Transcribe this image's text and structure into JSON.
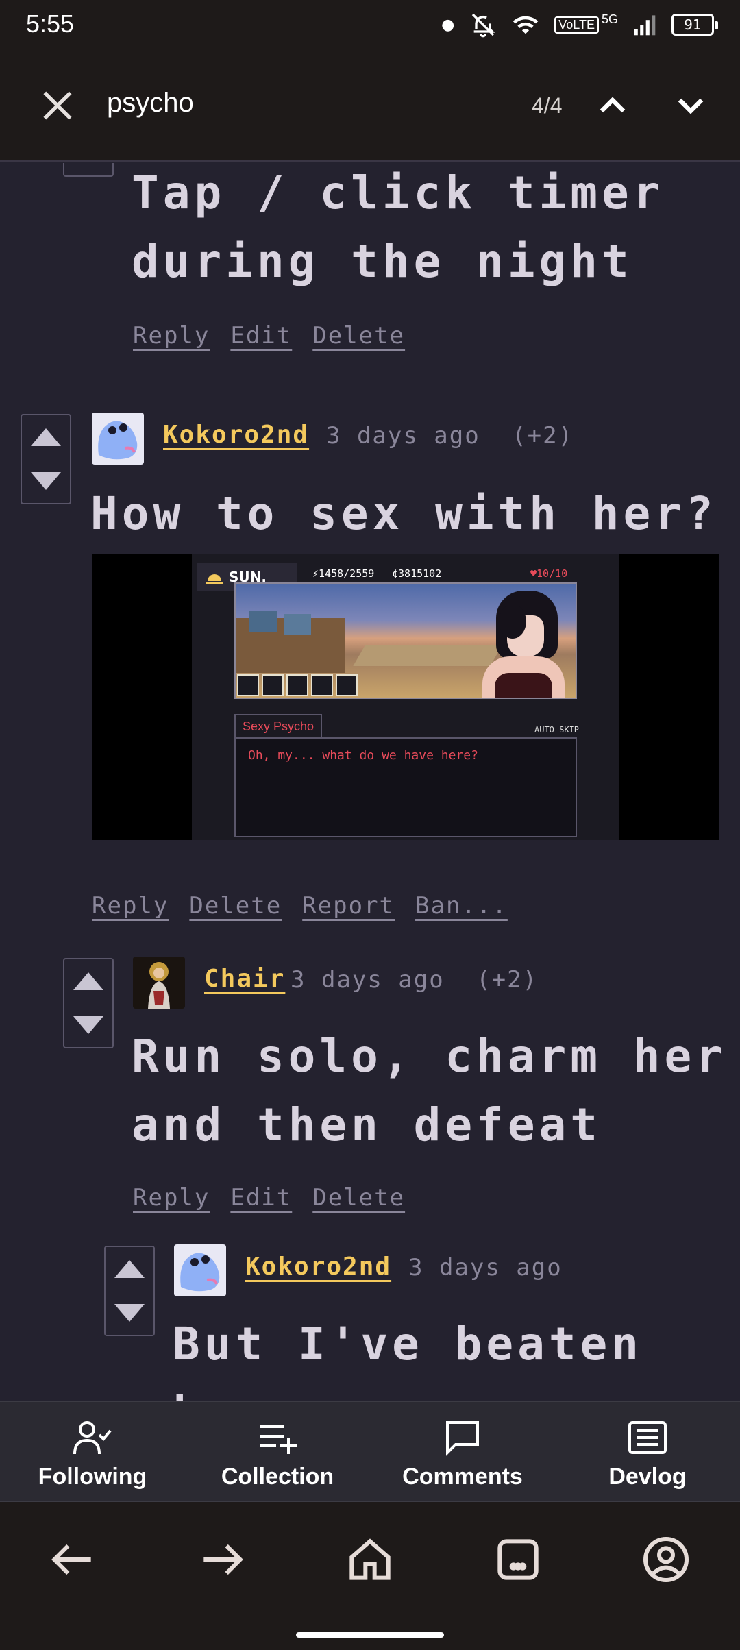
{
  "status": {
    "time": "5:55",
    "network": "5G",
    "volte": "VoLTE",
    "battery": "91"
  },
  "find": {
    "query": "psycho",
    "count": "4/4"
  },
  "comments": [
    {
      "text_lines": [
        "Tap / click timer",
        "during the night"
      ],
      "actions": [
        "Reply",
        "Edit",
        "Delete"
      ]
    },
    {
      "user": "Kokoro2nd",
      "time": "3 days ago",
      "score": "(+2)",
      "text_lines": [
        "How to sex with her?"
      ],
      "actions": [
        "Reply",
        "Delete",
        "Report",
        "Ban..."
      ]
    },
    {
      "user": "Chair",
      "time": "3 days ago",
      "score": "(+2)",
      "text_lines": [
        "Run solo, charm her",
        "and then defeat"
      ],
      "actions": [
        "Reply",
        "Edit",
        "Delete"
      ]
    },
    {
      "user": "Kokoro2nd",
      "time": "3 days ago",
      "text_lines": [
        "But I've beaten her"
      ]
    }
  ],
  "game": {
    "day": "SUN.",
    "energy": "⚡1458/2559",
    "money": "¢3815102",
    "hearts": "♥10/10",
    "speaker": "Sexy Psycho",
    "autoskip": "AUTO-SKIP",
    "dialogue": "Oh, my... what do we have here?"
  },
  "tabs": [
    {
      "label": "Following",
      "icon": "user-check-icon"
    },
    {
      "label": "Collection",
      "icon": "list-plus-icon"
    },
    {
      "label": "Comments",
      "icon": "message-icon"
    },
    {
      "label": "Devlog",
      "icon": "newspaper-icon"
    }
  ],
  "colors": {
    "background": "#24222f",
    "username": "#f4c95d",
    "muted": "#8a869a",
    "body": "#d9d3df"
  }
}
